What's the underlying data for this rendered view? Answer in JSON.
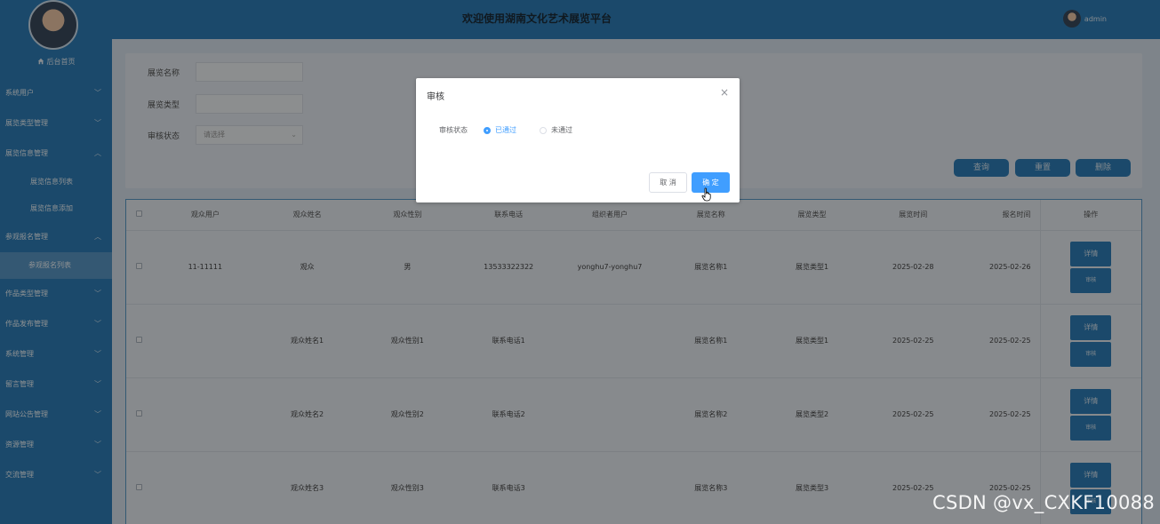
{
  "header": {
    "title": "欢迎使用湖南文化艺术展览平台",
    "username": "admin"
  },
  "sidebar": {
    "home": "后台首页",
    "items": [
      {
        "label": "系统用户",
        "chevron": "﹀"
      },
      {
        "label": "展览类型管理",
        "chevron": "﹀"
      },
      {
        "label": "展览信息管理",
        "chevron": "︿"
      },
      {
        "label": "参观报名管理",
        "chevron": "︿"
      },
      {
        "label": "作品类型管理",
        "chevron": "﹀"
      },
      {
        "label": "作品发布管理",
        "chevron": "﹀"
      },
      {
        "label": "系统管理",
        "chevron": "﹀"
      },
      {
        "label": "留言管理",
        "chevron": "﹀"
      },
      {
        "label": "网站公告管理",
        "chevron": "﹀"
      },
      {
        "label": "资源管理",
        "chevron": "﹀"
      },
      {
        "label": "交流管理",
        "chevron": "﹀"
      }
    ],
    "exhibition_sub": [
      "展览信息列表",
      "展览信息添加"
    ],
    "registration_sub": [
      "参观报名列表"
    ]
  },
  "search": {
    "name_label": "展览名称",
    "type_label": "展览类型",
    "status_label": "审核状态",
    "status_placeholder": "请选择",
    "query_btn": "查询",
    "reset_btn": "重置",
    "delete_btn": "删除"
  },
  "table": {
    "headers": [
      "观众用户",
      "观众姓名",
      "观众性别",
      "联系电话",
      "组织者用户",
      "展览名称",
      "展览类型",
      "展览时间",
      "报名时间",
      "操作"
    ],
    "rows": [
      [
        "11-11111",
        "观众",
        "男",
        "13533322322",
        "yonghu7-yonghu7",
        "展览名称1",
        "展览类型1",
        "2025-02-28",
        "2025-02-26"
      ],
      [
        "",
        "观众姓名1",
        "观众性别1",
        "联系电话1",
        "",
        "展览名称1",
        "展览类型1",
        "2025-02-25",
        "2025-02-25"
      ],
      [
        "",
        "观众姓名2",
        "观众性别2",
        "联系电话2",
        "",
        "展览名称2",
        "展览类型2",
        "2025-02-25",
        "2025-02-25"
      ],
      [
        "",
        "观众姓名3",
        "观众性别3",
        "联系电话3",
        "",
        "展览名称3",
        "展览类型3",
        "2025-02-25",
        "2025-02-25"
      ]
    ],
    "detail_btn": "详情",
    "review_btn": "审核"
  },
  "dialog": {
    "title": "审核",
    "close": "×",
    "field_label": "审核状态",
    "option_pass": "已通过",
    "option_fail": "未通过",
    "selected": "已通过",
    "cancel": "取 消",
    "ok": "确 定"
  },
  "watermark": "CSDN @vx_CXKF10088",
  "colors": {
    "primary": "#2f7fb8",
    "dialog_accent": "#409eff"
  }
}
